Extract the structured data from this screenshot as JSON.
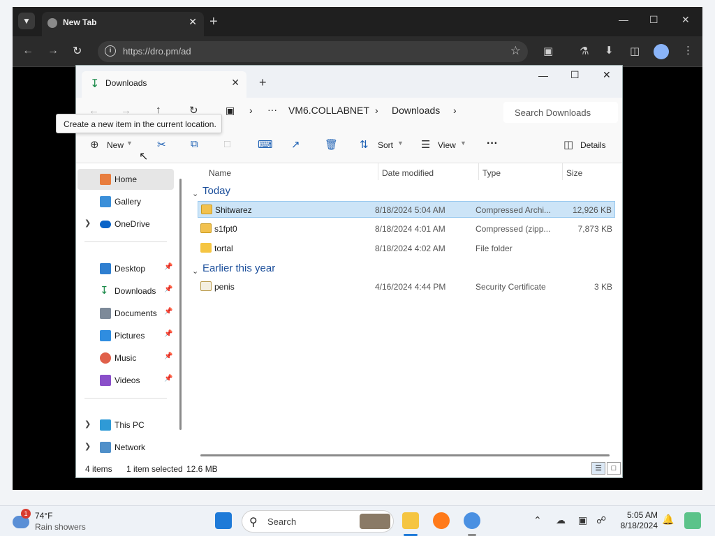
{
  "browser": {
    "tab_title": "New Tab",
    "url": "https://dro.pm/ad"
  },
  "explorer": {
    "tab_title": "Downloads",
    "breadcrumb": {
      "ellipsis": "···",
      "computer": "VM6.COLLABNET",
      "folder": "Downloads"
    },
    "search_placeholder": "Search Downloads",
    "tooltip": "Create a new item in the current location.",
    "commands": {
      "new": "New",
      "sort": "Sort",
      "view": "View",
      "more": "···",
      "details": "Details"
    },
    "sidebar": {
      "items": [
        {
          "label": "Home",
          "icon": "home-icon",
          "selected": true
        },
        {
          "label": "Gallery",
          "icon": "gallery-icon"
        },
        {
          "label": "OneDrive",
          "icon": "cloud-icon",
          "expandable": true
        },
        {
          "label": "Desktop",
          "icon": "desktop-folder-icon",
          "pinned": true
        },
        {
          "label": "Downloads",
          "icon": "download-folder-icon",
          "pinned": true
        },
        {
          "label": "Documents",
          "icon": "documents-folder-icon",
          "pinned": true
        },
        {
          "label": "Pictures",
          "icon": "pictures-folder-icon",
          "pinned": true
        },
        {
          "label": "Music",
          "icon": "music-folder-icon",
          "pinned": true
        },
        {
          "label": "Videos",
          "icon": "videos-folder-icon",
          "pinned": true
        },
        {
          "label": "This PC",
          "icon": "pc-icon",
          "expandable": true
        },
        {
          "label": "Network",
          "icon": "network-icon",
          "expandable": true
        }
      ]
    },
    "columns": [
      "Name",
      "Date modified",
      "Type",
      "Size"
    ],
    "groups": [
      {
        "label": "Today",
        "files": [
          {
            "name": "Shitwarez",
            "date": "8/18/2024 5:04 AM",
            "type": "Compressed Archi...",
            "size": "12,926 KB",
            "icon": "zip-folder-icon",
            "selected": true
          },
          {
            "name": "s1fpt0",
            "date": "8/18/2024 4:01 AM",
            "type": "Compressed (zipp...",
            "size": "7,873 KB",
            "icon": "zip-folder-icon"
          },
          {
            "name": "tortal",
            "date": "8/18/2024 4:02 AM",
            "type": "File folder",
            "size": "",
            "icon": "folder-icon"
          }
        ]
      },
      {
        "label": "Earlier this year",
        "files": [
          {
            "name": "penis",
            "date": "4/16/2024 4:44 PM",
            "type": "Security Certificate",
            "size": "3 KB",
            "icon": "certificate-icon"
          }
        ]
      }
    ],
    "status": {
      "count": "4 items",
      "selected": "1 item selected",
      "size": "12.6 MB"
    }
  },
  "taskbar": {
    "weather_temp": "74°F",
    "weather_desc": "Rain showers",
    "weather_badge": "1",
    "search_label": "Search",
    "time": "5:05 AM",
    "date": "8/18/2024"
  },
  "colors": {
    "selection": "#cce4f7",
    "group_header": "#1c4f9b",
    "accent": "#1b5fb3"
  }
}
